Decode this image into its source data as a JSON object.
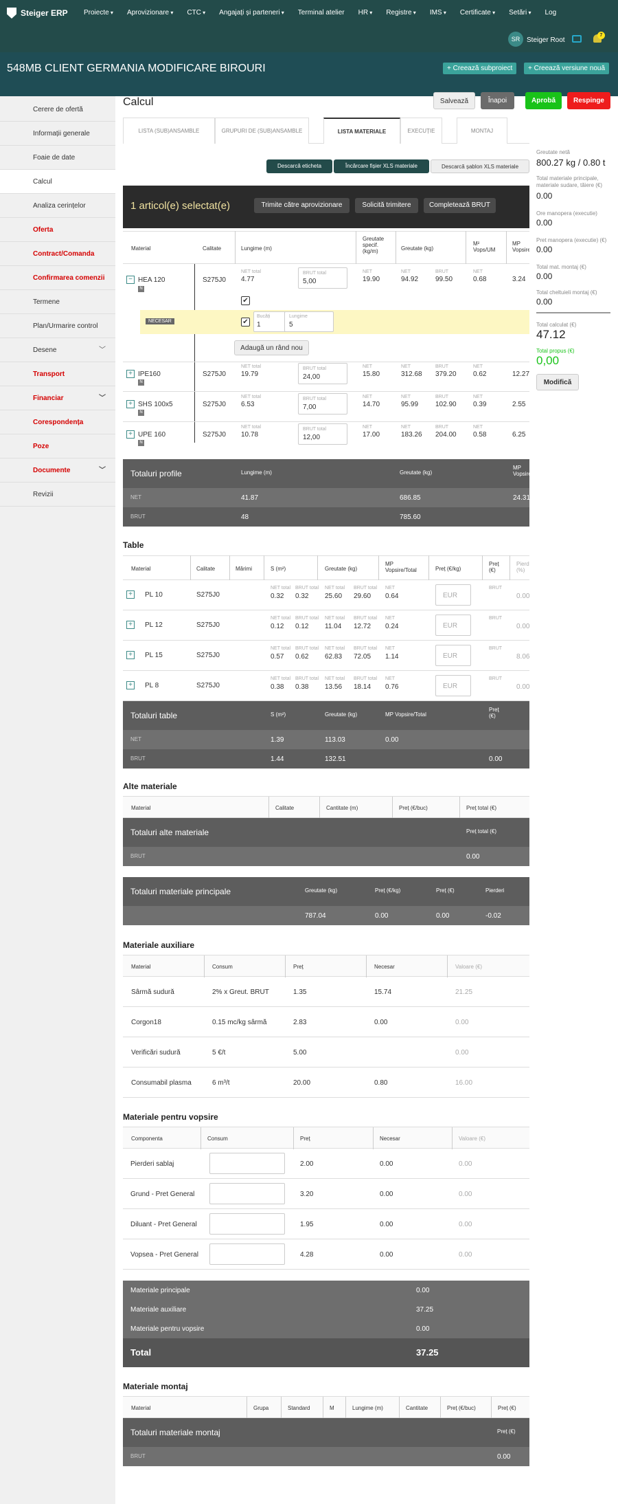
{
  "app": {
    "name": "Steiger ERP",
    "nav": [
      "Proiecte",
      "Aprovizionare",
      "CTC",
      "Angajați și parteneri",
      "Terminal atelier",
      "HR",
      "Registre",
      "IMS",
      "Certificate",
      "Setări",
      "Log"
    ],
    "user_initials": "SR",
    "user_name": "Steiger Root",
    "notif_count": "7"
  },
  "project": {
    "title": "548MB CLIENT GERMANIA MODIFICARE BIROURI",
    "btn_sub": "+ Creează subproiect",
    "btn_ver": "+ Creează versiune nouă"
  },
  "sidebar": [
    "Cerere de ofertă",
    "Informații generale",
    "Foaie de date",
    "Calcul",
    "Analiza cerințelor",
    "Oferta",
    "Contract/Comanda",
    "Confirmarea comenzii",
    "Termene",
    "Plan/Urmarire control",
    "Desene",
    "Transport",
    "Financiar",
    "Corespondența",
    "Poze",
    "Documente",
    "Revizii"
  ],
  "header": {
    "title": "Calcul",
    "save": "Salvează",
    "back": "Înapoi",
    "approve": "Aprobă",
    "reject": "Respinge"
  },
  "tabs": [
    "LISTA (SUB)ANSAMBLE",
    "GRUPURI DE (SUB)ANSAMBLE",
    "LISTA MATERIALE",
    "EXECUȚIE",
    "MONTAJ"
  ],
  "toolbar": {
    "b1": "Descarcă eticheta",
    "b2": "Încărcare fișier XLS materiale",
    "b3": "Descarcă șablon XLS materiale"
  },
  "selection": {
    "title": "1 articol(e) selectat(e)",
    "b1": "Trimite către aprovizionare",
    "b2": "Solicită trimitere",
    "b3": "Completează BRUT"
  },
  "profile_headers": [
    "Material",
    "Calitate",
    "Lungime (m)",
    "Greutate specif. (kg/m)",
    "Greutate (kg)",
    "M² Vops/UM",
    "MP Vopsire"
  ],
  "labels": {
    "net_total": "NET total",
    "brut_total": "BRUT total",
    "net": "NET",
    "brut": "BRUT",
    "bucati": "Bucăți",
    "lungime": "Lungime",
    "necesar": "NECESAR",
    "add_row": "Adaugă un rând nou",
    "n": "N",
    "eur": "EUR"
  },
  "profiles": [
    {
      "name": "HEA 120",
      "q": "S275J0",
      "net": "4.77",
      "brut": "5,00",
      "gs": "19.90",
      "gn": "94.92",
      "gb": "99.50",
      "m2": "0.68",
      "mp": "3.24"
    },
    {
      "name": "IPE160",
      "q": "S275J0",
      "net": "19.79",
      "brut": "24,00",
      "gs": "15.80",
      "gn": "312.68",
      "gb": "379.20",
      "m2": "0.62",
      "mp": "12.27"
    },
    {
      "name": "SHS 100x5",
      "q": "S275J0",
      "net": "6.53",
      "brut": "7,00",
      "gs": "14.70",
      "gn": "95.99",
      "gb": "102.90",
      "m2": "0.39",
      "mp": "2.55"
    },
    {
      "name": "UPE 160",
      "q": "S275J0",
      "net": "10.78",
      "brut": "12,00",
      "gs": "17.00",
      "gn": "183.26",
      "gb": "204.00",
      "m2": "0.58",
      "mp": "6.25"
    }
  ],
  "subrow": {
    "buc": "1",
    "lung": "5"
  },
  "tot_profile": {
    "title": "Totaluri profile",
    "h1": "Lungime (m)",
    "h2": "Greutate (kg)",
    "h3": "MP Vopsire",
    "net_l": "NET",
    "brut_l": "BRUT",
    "net1": "41.87",
    "net2": "686.85",
    "net3": "24.31",
    "brut1": "48",
    "brut2": "785.60"
  },
  "table_sec": "Table",
  "table_headers": [
    "Material",
    "Calitate",
    "Mărimi",
    "S (m²)",
    "Greutate (kg)",
    "MP Vopsire/Total",
    "Preț (€/kg)",
    "Preț (€)",
    "Pierderi (%)"
  ],
  "plates": [
    {
      "name": "PL 10",
      "q": "S275J0",
      "sn": "0.32",
      "sb": "0.32",
      "gn": "25.60",
      "gb": "29.60",
      "mp": "0.64",
      "p": "0.00"
    },
    {
      "name": "PL 12",
      "q": "S275J0",
      "sn": "0.12",
      "sb": "0.12",
      "gn": "11.04",
      "gb": "12.72",
      "mp": "0.24",
      "p": "0.00"
    },
    {
      "name": "PL 15",
      "q": "S275J0",
      "sn": "0.57",
      "sb": "0.62",
      "gn": "62.83",
      "gb": "72.05",
      "mp": "1.14",
      "p": "8.06"
    },
    {
      "name": "PL 8",
      "q": "S275J0",
      "sn": "0.38",
      "sb": "0.38",
      "gn": "13.56",
      "gb": "18.14",
      "mp": "0.76",
      "p": "0.00"
    }
  ],
  "tot_table": {
    "title": "Totaluri table",
    "h1": "S (m²)",
    "h2": "Greutate (kg)",
    "h3": "MP Vopsire/Total",
    "h4": "Preț (€)",
    "n1": "1.39",
    "n2": "113.03",
    "n3": "0.00",
    "b1": "1.44",
    "b2": "132.51",
    "b4": "0.00"
  },
  "alte": {
    "title": "Alte materiale",
    "h": [
      "Material",
      "Calitate",
      "Cantitate (m)",
      "Preț (€/buc)",
      "Preț total (€)"
    ],
    "tot": "Totaluri alte materiale",
    "tot_h": "Preț total (€)",
    "brut": "BRUT",
    "val": "0.00"
  },
  "tot_main": {
    "title": "Totaluri materiale principale",
    "h": [
      "Greutate (kg)",
      "Preț (€/kg)",
      "Preț (€)",
      "Pierderi"
    ],
    "v": [
      "787.04",
      "0.00",
      "0.00",
      "-0.02"
    ]
  },
  "aux": {
    "title": "Materiale auxiliare",
    "h": [
      "Material",
      "Consum",
      "Preț",
      "Necesar",
      "Valoare (€)"
    ],
    "rows": [
      [
        "Sârmă sudură",
        "2% x Greut. BRUT",
        "1.35",
        "15.74",
        "21.25"
      ],
      [
        "Corgon18",
        "0.15 mc/kg sârmă",
        "2.83",
        "0.00",
        "0.00"
      ],
      [
        "Verificări sudură",
        "5 €/t",
        "5.00",
        "",
        "0.00"
      ],
      [
        "Consumabil plasma",
        "6 m³/t",
        "20.00",
        "0.80",
        "16.00"
      ]
    ]
  },
  "paint": {
    "title": "Materiale pentru vopsire",
    "h": [
      "Componenta",
      "Consum",
      "Preț",
      "Necesar",
      "Valoare (€)"
    ],
    "rows": [
      [
        "Pierderi sablaj",
        "2.00",
        "0.00",
        "0.00"
      ],
      [
        "Grund - Pret General",
        "3.20",
        "0.00",
        "0.00"
      ],
      [
        "Diluant - Pret General",
        "1.95",
        "0.00",
        "0.00"
      ],
      [
        "Vopsea - Pret General",
        "4.28",
        "0.00",
        "0.00"
      ]
    ]
  },
  "summary": {
    "rows": [
      [
        "Materiale principale",
        "0.00"
      ],
      [
        "Materiale auxiliare",
        "37.25"
      ],
      [
        "Materiale pentru vopsire",
        "0.00"
      ]
    ],
    "total_l": "Total",
    "total_v": "37.25"
  },
  "montaj": {
    "title": "Materiale montaj",
    "h": [
      "Material",
      "Grupa",
      "Standard",
      "M",
      "Lungime (m)",
      "Cantitate",
      "Preț (€/buc)",
      "Preț (€)"
    ],
    "tot": "Totaluri materiale montaj",
    "tot_h": "Preț (€)",
    "brut": "BRUT",
    "val": "0.00"
  },
  "right": {
    "l1": "Greutate netă",
    "v1": "800.27 kg / 0.80 t",
    "l2": "Total materiale principale, materiale sudare, tăiere (€)",
    "v2": "0.00",
    "l3": "Ore manopera (executie)",
    "v3": "0.00",
    "l4": "Pret manopera (executie) (€)",
    "v4": "0.00",
    "l5": "Total mat. montaj (€)",
    "v5": "0.00",
    "l6": "Total cheltuieli montaj (€)",
    "v6": "0.00",
    "l7": "Total calculat (€)",
    "v7": "47.12",
    "l8": "Total propus (€)",
    "v8": "0,00",
    "btn": "Modifică"
  },
  "colors": {
    "topbar": "#234b4a",
    "accent": "#3ba39b",
    "approve": "#19c319",
    "reject": "#ee1c1c",
    "dark_total": "#5d5d5d"
  }
}
